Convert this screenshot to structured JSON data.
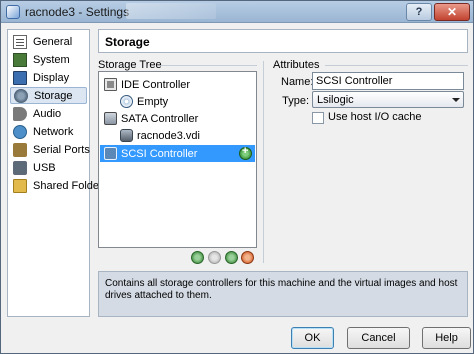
{
  "window": {
    "title": "racnode3 - Settings",
    "close_symbol": "✕",
    "help_symbol": "?"
  },
  "sidebar": {
    "items": [
      {
        "label": "General",
        "icon": "general-icon"
      },
      {
        "label": "System",
        "icon": "system-icon"
      },
      {
        "label": "Display",
        "icon": "display-icon"
      },
      {
        "label": "Storage",
        "icon": "storage-icon",
        "selected": true
      },
      {
        "label": "Audio",
        "icon": "audio-icon"
      },
      {
        "label": "Network",
        "icon": "network-icon"
      },
      {
        "label": "Serial Ports",
        "icon": "serial-ports-icon"
      },
      {
        "label": "USB",
        "icon": "usb-icon"
      },
      {
        "label": "Shared Folders",
        "icon": "shared-folders-icon"
      }
    ]
  },
  "header": {
    "title": "Storage"
  },
  "storage_tree": {
    "label": "Storage Tree",
    "items": [
      {
        "label": "IDE Controller",
        "type": "controller"
      },
      {
        "label": "Empty",
        "type": "cd-drive"
      },
      {
        "label": "SATA Controller",
        "type": "controller"
      },
      {
        "label": "racnode3.vdi",
        "type": "hard-disk"
      },
      {
        "label": "SCSI Controller",
        "type": "controller",
        "selected": true
      }
    ]
  },
  "attributes": {
    "label": "Attributes",
    "name_label": "Name:",
    "name_value": "SCSI Controller",
    "type_label": "Type:",
    "type_value": "Lsilogic",
    "host_io_cache_label": "Use host I/O cache",
    "host_io_cache_checked": false
  },
  "info": {
    "text": "Contains all storage controllers for this machine and the virtual images and host drives attached to them."
  },
  "buttons": {
    "ok": "OK",
    "cancel": "Cancel",
    "help": "Help"
  },
  "colors": {
    "selection": "#3399ff",
    "info_background": "#d4dbe4"
  }
}
